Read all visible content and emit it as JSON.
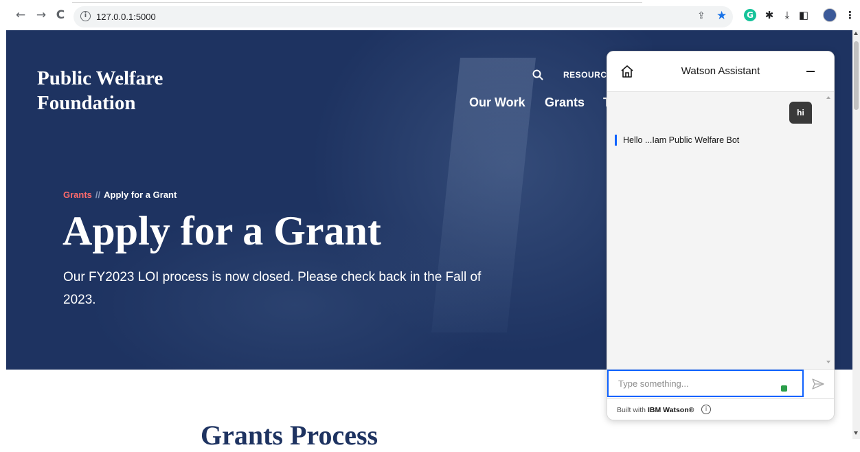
{
  "browser": {
    "url": "127.0.0.1:5000",
    "icons": {
      "back": "back-arrow-icon",
      "forward": "forward-arrow-icon",
      "reload": "reload-icon",
      "info": "site-info-icon",
      "share": "share-icon",
      "bookmark": "star-icon",
      "grammarly": "grammarly-icon",
      "extensions": "puzzle-icon",
      "downloads": "download-icon",
      "sidepanel": "side-panel-icon",
      "profile": "profile-avatar-icon",
      "menu": "kebab-menu-icon"
    }
  },
  "site": {
    "logo_line1": "Public Welfare",
    "logo_line2": "Foundation",
    "top_links": {
      "resources": "RESOURCE"
    },
    "nav": {
      "our_work": "Our Work",
      "grants": "Grants",
      "partial": "T"
    },
    "breadcrumb": {
      "parent": "Grants",
      "separator": "//",
      "current": "Apply for a Grant"
    },
    "hero": {
      "title": "Apply for a Grant",
      "subtitle": "Our FY2023 LOI process is now closed. Please check back in the Fall of 2023."
    },
    "section_title": "Grants Process",
    "colors": {
      "hero_bg": "#1e3361",
      "breadcrumb_link": "#ff6b6b"
    }
  },
  "watson": {
    "title": "Watson Assistant",
    "messages": [
      {
        "from": "user",
        "text": "hi"
      },
      {
        "from": "bot",
        "text": "Hello ...Iam Public Welfare Bot"
      }
    ],
    "help_label": "?",
    "input_placeholder": "Type something...",
    "footer_prefix": "Built with",
    "footer_brand": "IBM Watson®",
    "accent_color": "#0f62fe"
  }
}
